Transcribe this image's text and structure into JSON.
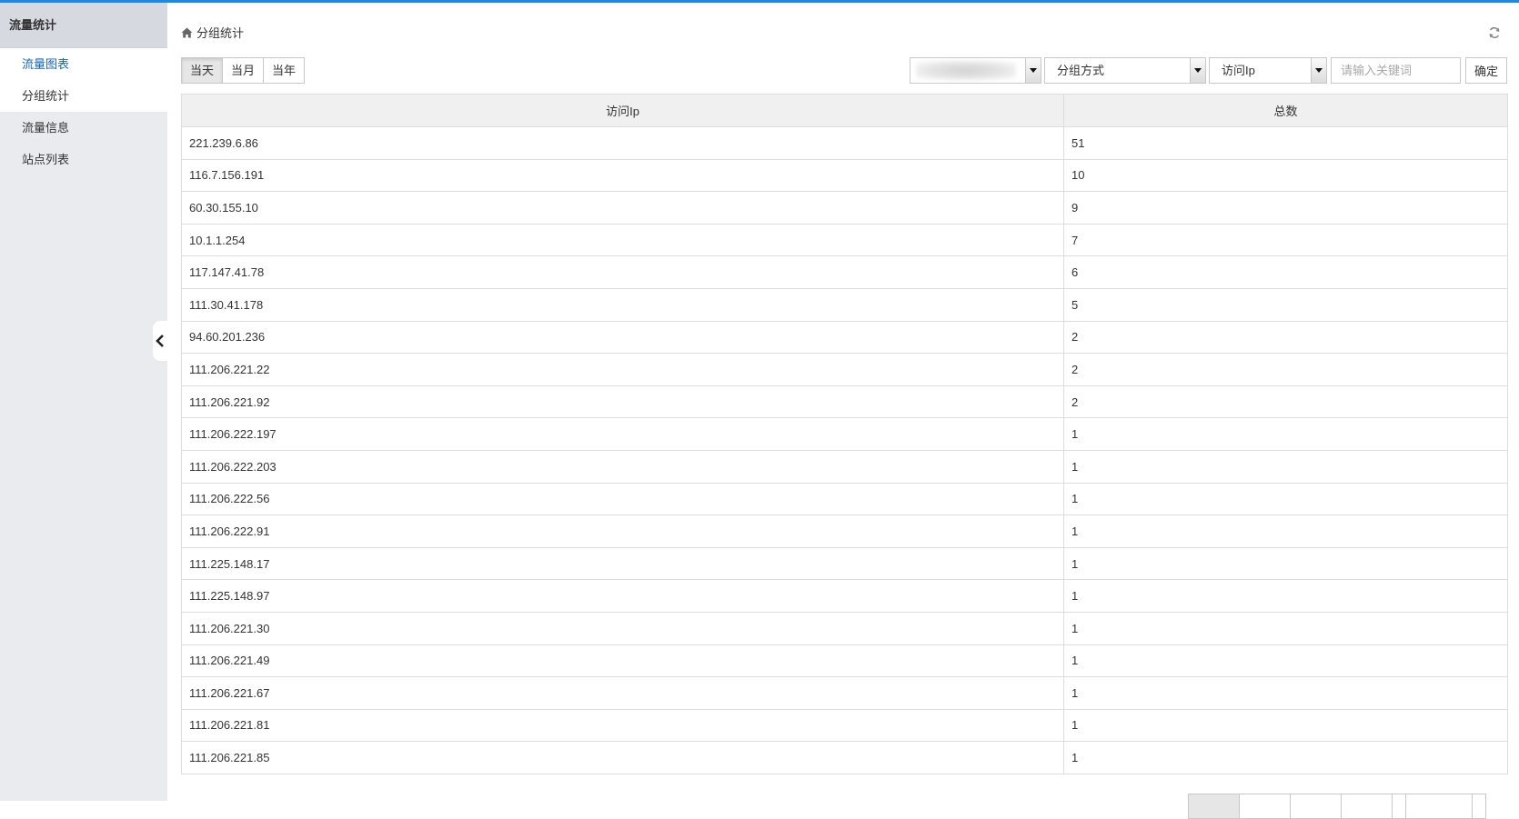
{
  "sidebar": {
    "title": "流量统计",
    "items": [
      {
        "label": "流量图表"
      },
      {
        "label": "分组统计"
      },
      {
        "label": "流量信息"
      },
      {
        "label": "站点列表"
      }
    ]
  },
  "breadcrumb": {
    "title": "分组统计"
  },
  "toolbar": {
    "ranges": [
      "当天",
      "当月",
      "当年"
    ],
    "group_select": "分组方式",
    "field_select": "访问Ip",
    "search_placeholder": "请输入关键词",
    "confirm_label": "确定"
  },
  "table": {
    "columns": [
      "访问Ip",
      "总数"
    ],
    "rows": [
      [
        "221.239.6.86",
        "51"
      ],
      [
        "116.7.156.191",
        "10"
      ],
      [
        "60.30.155.10",
        "9"
      ],
      [
        "10.1.1.254",
        "7"
      ],
      [
        "117.147.41.78",
        "6"
      ],
      [
        "111.30.41.178",
        "5"
      ],
      [
        "94.60.201.236",
        "2"
      ],
      [
        "111.206.221.22",
        "2"
      ],
      [
        "111.206.221.92",
        "2"
      ],
      [
        "111.206.222.197",
        "1"
      ],
      [
        "111.206.222.203",
        "1"
      ],
      [
        "111.206.222.56",
        "1"
      ],
      [
        "111.206.222.91",
        "1"
      ],
      [
        "111.225.148.17",
        "1"
      ],
      [
        "111.225.148.97",
        "1"
      ],
      [
        "111.206.221.30",
        "1"
      ],
      [
        "111.206.221.49",
        "1"
      ],
      [
        "111.206.221.67",
        "1"
      ],
      [
        "111.206.221.81",
        "1"
      ],
      [
        "111.206.221.85",
        "1"
      ]
    ]
  },
  "colors": {
    "accent": "#1e88e5",
    "active_link": "#1565c0",
    "sidebar_bg": "#e9ebef",
    "header_bg": "#f0f0f0"
  },
  "icons": {
    "home": "home-icon",
    "refresh": "refresh-icon",
    "collapse": "chevron-left-icon",
    "dropdown": "caret-down-icon"
  }
}
